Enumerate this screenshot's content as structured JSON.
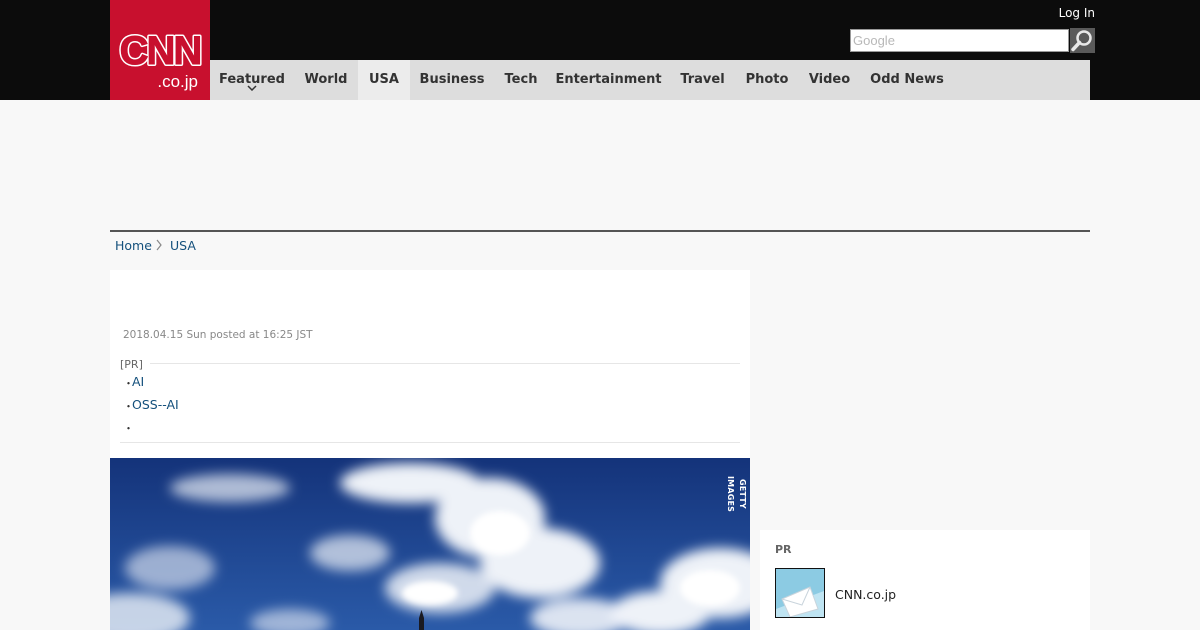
{
  "header": {
    "logo": {
      "line1": "CNN",
      "line2": ".co.jp"
    },
    "login_label": "Log In",
    "search": {
      "placeholder": "Google",
      "button_icon": "magnifier-icon"
    },
    "colors": {
      "topbar": "#0c0c0c",
      "logo_red": "#c8102e",
      "nav_bg": "#dddddd"
    }
  },
  "nav": {
    "items": [
      {
        "label": "Featured",
        "has_dropdown": true
      },
      {
        "label": "World"
      },
      {
        "label": "USA",
        "active": true
      },
      {
        "label": "Business"
      },
      {
        "label": "Tech"
      },
      {
        "label": "Entertainment"
      },
      {
        "label": "Travel"
      },
      {
        "label": "Photo"
      },
      {
        "label": "Video"
      },
      {
        "label": "Odd News"
      }
    ],
    "dropdown_icon": "chevron-down-icon"
  },
  "breadcrumb": {
    "home": "Home",
    "current": "USA",
    "separator_icon": "chevron-right-icon"
  },
  "article": {
    "date": "2018.04.15 Sun posted at 16:25 JST",
    "pr": {
      "label": "[PR]",
      "bullet": "・",
      "links": [
        "AI",
        "OSS--AI",
        ""
      ]
    },
    "photo": {
      "credit": "GETTY IMAGES",
      "description_icon": "sky-photo"
    }
  },
  "sidebar": {
    "pr": {
      "label": "PR",
      "item_text": "CNN.co.jp",
      "thumb_icon": "mail-envelope-icon"
    }
  }
}
